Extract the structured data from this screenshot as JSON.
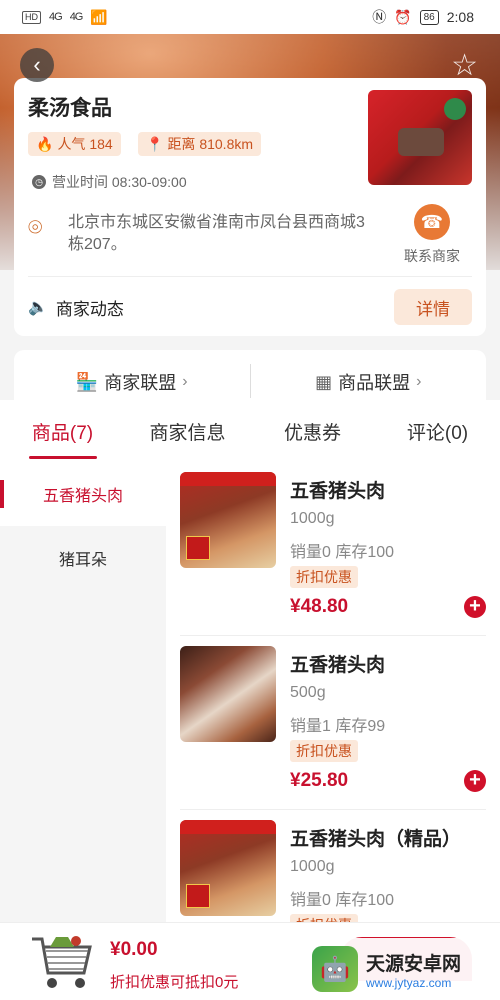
{
  "status_bar": {
    "hd": "HD",
    "sig1": "4G",
    "sig2": "4G",
    "battery": "86",
    "time": "2:08"
  },
  "store": {
    "name": "柔汤食品",
    "popularity_label": "人气 184",
    "distance_label": "距离 810.8km",
    "hours": "营业时间 08:30-09:00",
    "address": "北京市东城区安徽省淮南市凤台县西商城3栋207。",
    "contact_label": "联系商家",
    "news_label": "商家动态",
    "detail_label": "详情"
  },
  "alliance": {
    "merchant": "商家联盟",
    "goods": "商品联盟"
  },
  "tabs": [
    "商品(7)",
    "商家信息",
    "优惠券",
    "评论(0)"
  ],
  "categories": [
    "五香猪头肉",
    "猪耳朵"
  ],
  "products": [
    {
      "name": "五香猪头肉",
      "spec": "1000g",
      "stock": "销量0  库存100",
      "discount": "折扣优惠",
      "price": "¥48.80"
    },
    {
      "name": "五香猪头肉",
      "spec": "500g",
      "stock": "销量1  库存99",
      "discount": "折扣优惠",
      "price": "¥25.80"
    },
    {
      "name": "五香猪头肉（精品）",
      "spec": "1000g",
      "stock": "销量0  库存100",
      "discount": "折扣优惠",
      "price": ""
    }
  ],
  "cart": {
    "total": "¥0.00",
    "note": "折扣优惠可抵扣0元"
  },
  "watermark": {
    "title": "天源安卓网",
    "url": "www.jytyaz.com"
  },
  "colors": {
    "accent": "#c8102e",
    "tag_bg": "#fbe8da",
    "tag_text": "#c8521f"
  }
}
